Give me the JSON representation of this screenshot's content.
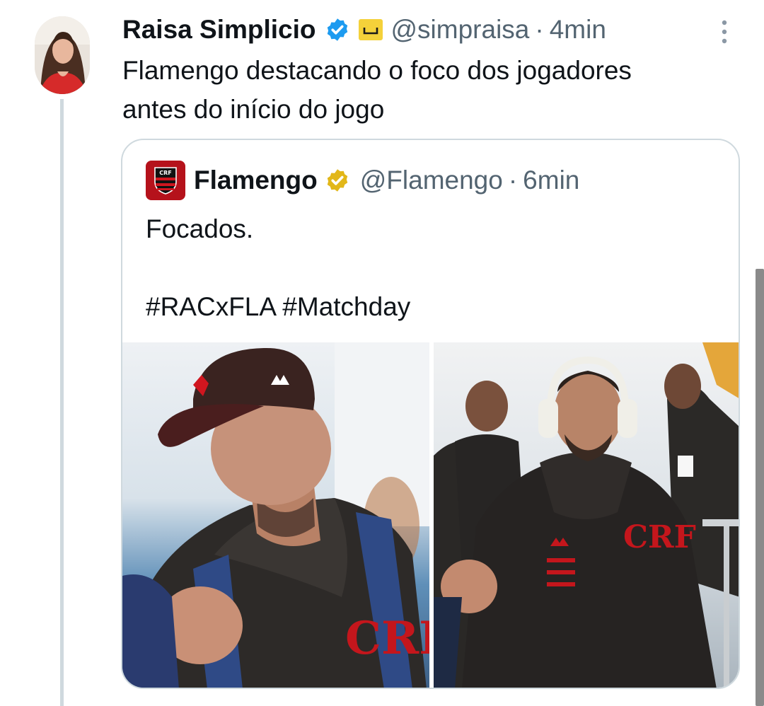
{
  "tweet": {
    "author_name": "Raisa Simplicio",
    "author_handle": "@simpraisa",
    "separator": "·",
    "time": "4min",
    "text_lines": [
      "Flamengo destacando o foco dos jogadores",
      "antes do início do jogo"
    ]
  },
  "quoted_tweet": {
    "author_name": "Flamengo",
    "author_handle": "@Flamengo",
    "separator": "·",
    "time": "6min",
    "text_line1": "Focados.",
    "text_line2": "#RACxFLA #Matchday"
  },
  "icons": {
    "verified_badge_color": "#1d9bf0",
    "org_badge_color": "#e2b719",
    "affiliation_icon": "yellow-label-icon",
    "more_icon": "more-vertical-icon"
  },
  "colors": {
    "text_primary": "#0f1419",
    "text_secondary": "#536471",
    "border": "#cfd9de",
    "flamengo_red": "#b5121b"
  }
}
